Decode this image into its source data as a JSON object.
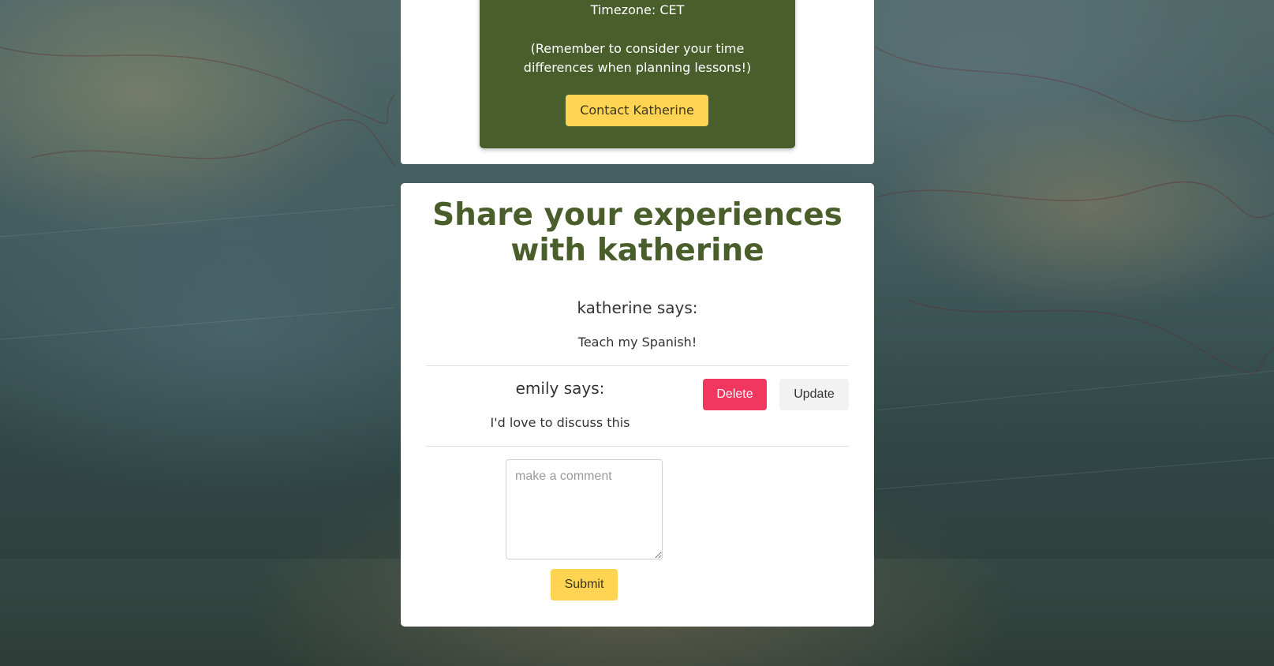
{
  "profile_panel": {
    "timezone": "Timezone: CET",
    "reminder": "(Remember to consider your time differences when planning lessons!)",
    "contact_label": "Contact Katherine"
  },
  "comments_section": {
    "heading": "Share your experiences with katherine",
    "comments": [
      {
        "author_line": "katherine says:",
        "text": "Teach my Spanish!"
      },
      {
        "author_line": "emily says:",
        "text": "I'd love to discuss this",
        "delete_label": "Delete",
        "update_label": "Update"
      }
    ],
    "new_comment": {
      "placeholder": "make a comment",
      "value": "",
      "submit_label": "Submit"
    }
  },
  "colors": {
    "panel_green": "#4a5e2c",
    "heading_green": "#4a5e2c",
    "accent_yellow": "#ffd452",
    "delete_red": "#f1375f",
    "update_gray": "#f2f2f2"
  }
}
